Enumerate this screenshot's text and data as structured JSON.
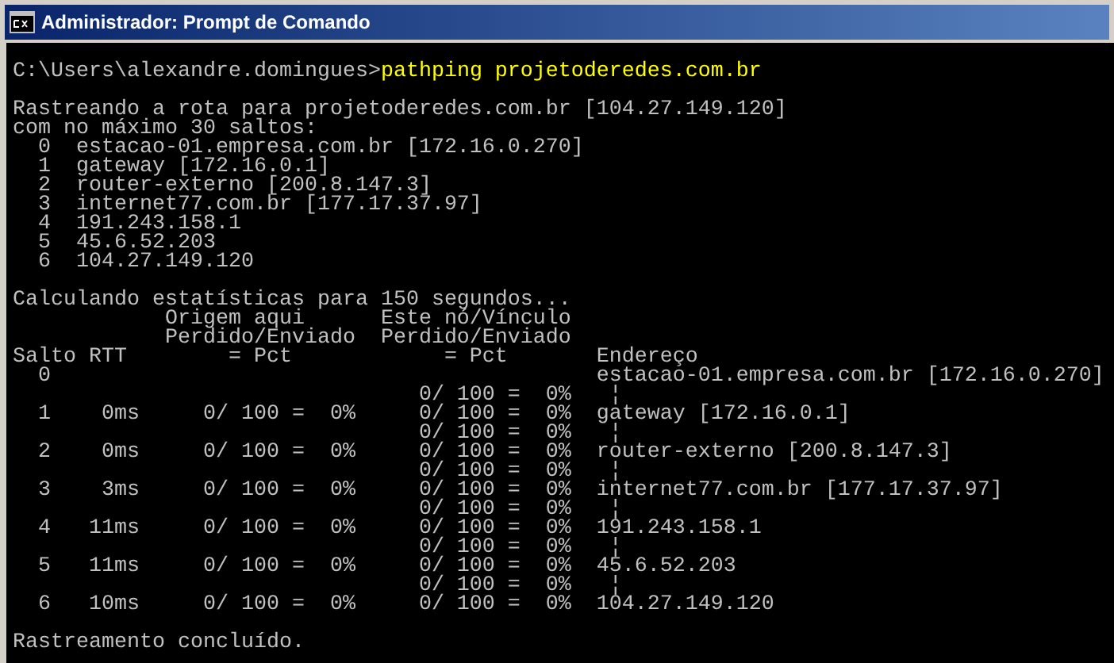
{
  "window": {
    "title": "Administrador: Prompt de Comando"
  },
  "lines": [
    {
      "kind": "prompt",
      "path": "C:\\Users\\alexandre.domingues>",
      "command": "pathping projetoderedes.com.br"
    },
    {
      "kind": "blank"
    },
    {
      "kind": "output",
      "text": "Rastreando a rota para projetoderedes.com.br [104.27.149.120]"
    },
    {
      "kind": "output",
      "text": "com no máximo 30 saltos:"
    },
    {
      "kind": "output",
      "text": "  0  estacao-01.empresa.com.br [172.16.0.270]"
    },
    {
      "kind": "output",
      "text": "  1  gateway [172.16.0.1]"
    },
    {
      "kind": "output",
      "text": "  2  router-externo [200.8.147.3]"
    },
    {
      "kind": "output",
      "text": "  3  internet77.com.br [177.17.37.97]"
    },
    {
      "kind": "output",
      "text": "  4  191.243.158.1"
    },
    {
      "kind": "output",
      "text": "  5  45.6.52.203"
    },
    {
      "kind": "output",
      "text": "  6  104.27.149.120"
    },
    {
      "kind": "blank"
    },
    {
      "kind": "output",
      "text": "Calculando estatísticas para 150 segundos..."
    },
    {
      "kind": "output",
      "text": "            Origem aqui      Este nó/Vínculo"
    },
    {
      "kind": "output",
      "text": "            Perdido/Enviado  Perdido/Enviado"
    },
    {
      "kind": "output",
      "text": "Salto RTT        = Pct            = Pct       Endereço"
    },
    {
      "kind": "output",
      "text": "  0                                           estacao-01.empresa.com.br [172.16.0.270]"
    },
    {
      "kind": "output",
      "text": "                                0/ 100 =  0%   ¦"
    },
    {
      "kind": "output",
      "text": "  1    0ms     0/ 100 =  0%     0/ 100 =  0%  gateway [172.16.0.1]"
    },
    {
      "kind": "output",
      "text": "                                0/ 100 =  0%   ¦"
    },
    {
      "kind": "output",
      "text": "  2    0ms     0/ 100 =  0%     0/ 100 =  0%  router-externo [200.8.147.3]"
    },
    {
      "kind": "output",
      "text": "                                0/ 100 =  0%   ¦"
    },
    {
      "kind": "output",
      "text": "  3    3ms     0/ 100 =  0%     0/ 100 =  0%  internet77.com.br [177.17.37.97]"
    },
    {
      "kind": "output",
      "text": "                                0/ 100 =  0%   ¦"
    },
    {
      "kind": "output",
      "text": "  4   11ms     0/ 100 =  0%     0/ 100 =  0%  191.243.158.1"
    },
    {
      "kind": "output",
      "text": "                                0/ 100 =  0%   ¦"
    },
    {
      "kind": "output",
      "text": "  5   11ms     0/ 100 =  0%     0/ 100 =  0%  45.6.52.203"
    },
    {
      "kind": "output",
      "text": "                                0/ 100 =  0%   ¦"
    },
    {
      "kind": "output",
      "text": "  6   10ms     0/ 100 =  0%     0/ 100 =  0%  104.27.149.120"
    },
    {
      "kind": "blank"
    },
    {
      "kind": "output",
      "text": "Rastreamento concluído."
    }
  ]
}
